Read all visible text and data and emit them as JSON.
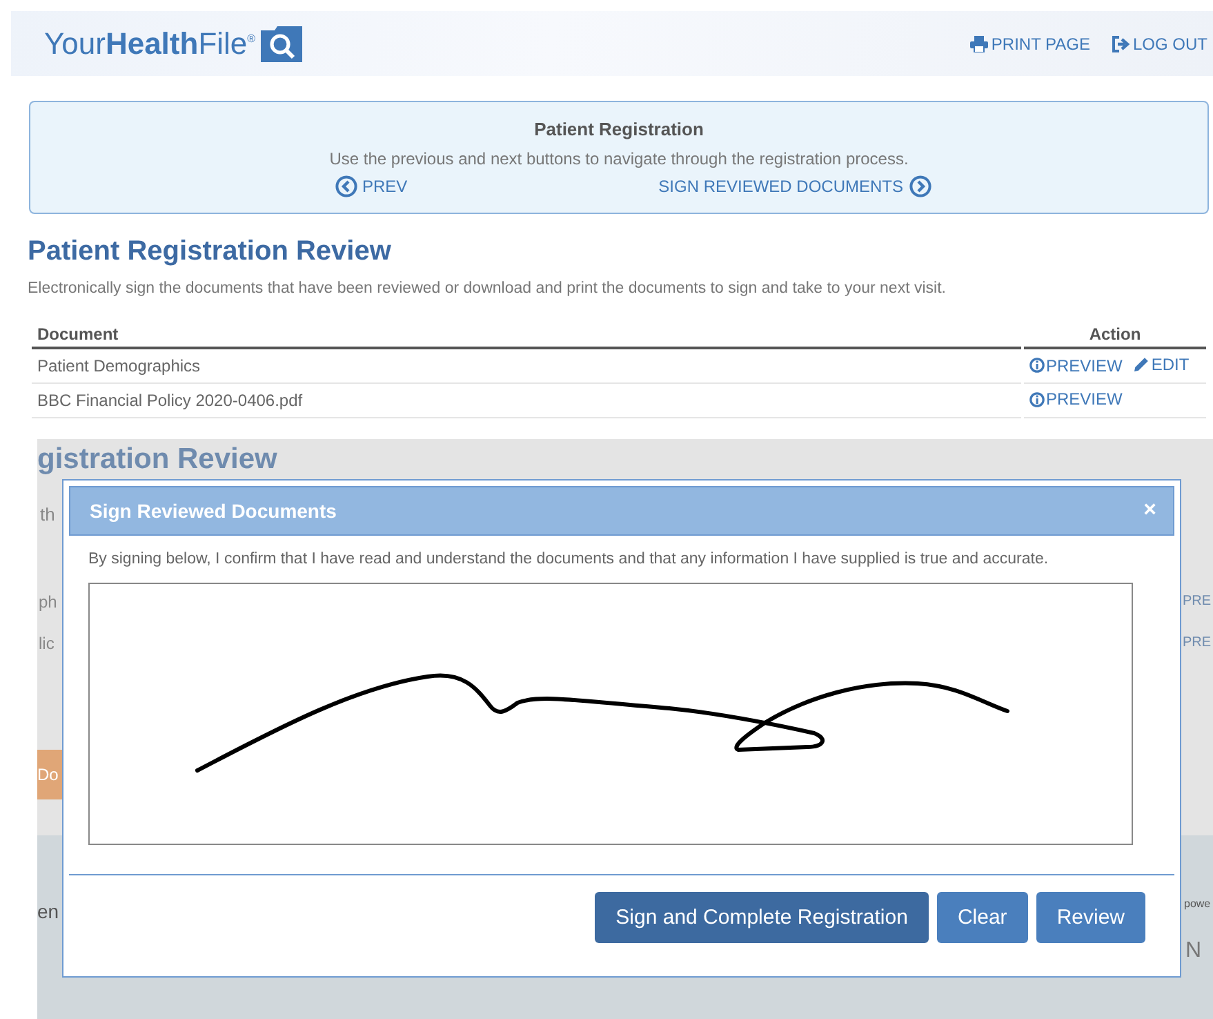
{
  "header": {
    "logo": {
      "plain_start": "Your",
      "bold": "Health",
      "plain_end": "File",
      "mark": "®"
    },
    "links": [
      {
        "kind": "print",
        "label": "PRINT PAGE"
      },
      {
        "kind": "logout",
        "label": "LOG OUT"
      }
    ]
  },
  "registration_nav": {
    "title": "Patient Registration",
    "instructions": "Use the previous and next buttons to navigate through the registration process.",
    "prev": "PREV",
    "next": "SIGN REVIEWED DOCUMENTS"
  },
  "page": {
    "title": "Patient Registration Review",
    "description": "Electronically sign the documents that have been reviewed or download and print the documents to sign and take to your next visit."
  },
  "table": {
    "columns": [
      "Document",
      "Action"
    ],
    "rows": [
      {
        "document": "Patient Demographics",
        "actions": [
          {
            "kind": "preview",
            "label": "PREVIEW"
          },
          {
            "kind": "edit",
            "label": "EDIT"
          }
        ]
      },
      {
        "document": "BBC Financial Policy 2020-0406.pdf",
        "actions": [
          {
            "kind": "preview",
            "label": "PREVIEW"
          }
        ]
      }
    ]
  },
  "overlay_background": {
    "heading": "gistration Review",
    "text": "th",
    "rows": [
      {
        "left": "ph",
        "right": "PRE"
      },
      {
        "left": "lic",
        "right": "PRE"
      }
    ],
    "button": "Do",
    "footer_logo": "en",
    "footer_right": [
      "powe",
      "N"
    ]
  },
  "modal": {
    "title": "Sign Reviewed Documents",
    "close": "×",
    "statement": "By signing below, I confirm that I have read and understand the documents and that any information I have supplied is true and accurate.",
    "buttons": [
      {
        "kind": "primary",
        "label": "Sign and Complete Registration"
      },
      {
        "kind": "secondary",
        "label": "Clear"
      },
      {
        "kind": "secondary",
        "label": "Review"
      }
    ]
  }
}
